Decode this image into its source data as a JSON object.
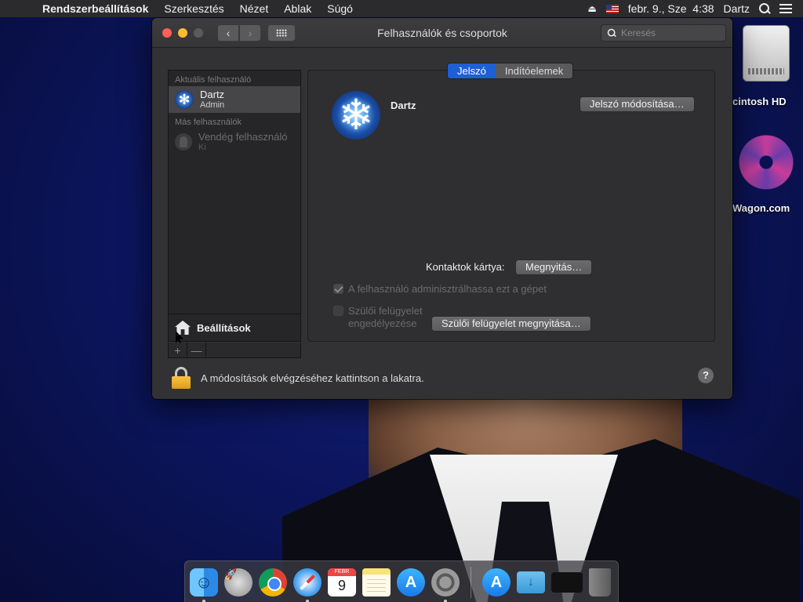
{
  "menubar": {
    "app_name": "Rendszerbeállítások",
    "items": [
      "Szerkesztés",
      "Nézet",
      "Ablak",
      "Súgó"
    ],
    "datetime": "febr. 9., Sze  4:38",
    "user": "Dartz"
  },
  "desktop": {
    "icons": [
      {
        "label": "cintosh HD",
        "icon": "hard-drive-icon"
      },
      {
        "label": "Wagon.com",
        "icon": "star-logo-icon"
      }
    ]
  },
  "window": {
    "title": "Felhasználók és csoportok",
    "search_placeholder": "Keresés",
    "sidebar": {
      "current_user_header": "Aktuális felhasználó",
      "current_user": {
        "name": "Dartz",
        "role": "Admin"
      },
      "other_users_header": "Más felhasználók",
      "other_users": [
        {
          "name": "Vendég felhasználó",
          "role": "Ki"
        }
      ],
      "settings_label": "Beállítások",
      "add_label": "+",
      "remove_label": "—"
    },
    "tabs": [
      {
        "label": "Jelszó",
        "active": true
      },
      {
        "label": "Indítóelemek",
        "active": false
      }
    ],
    "panel": {
      "username": "Dartz",
      "change_password_label": "Jelszó módosítása…",
      "contacts_card_label": "Kontaktok kártya:",
      "open_label": "Megnyitás…",
      "admin_checkbox_label": "A felhasználó adminisztrálhassa ezt a gépet",
      "admin_checked": true,
      "parental_checkbox_label_line1": "Szülői felügyelet",
      "parental_checkbox_label_line2": "engedélyezése",
      "parental_checked": false,
      "parental_open_label": "Szülői felügyelet megnyitása…"
    },
    "lock_text": "A módosítások elvégzéséhez kattintson a lakatra.",
    "help_label": "?"
  },
  "dock": {
    "calendar_month": "FEBR",
    "calendar_day": "9",
    "items": [
      "finder-icon",
      "launchpad-icon",
      "chrome-icon",
      "safari-icon",
      "calendar-icon",
      "notes-icon",
      "app-store-icon",
      "system-preferences-icon",
      "app-store-downloads-icon",
      "downloads-folder-icon",
      "screenshot-icon",
      "trash-icon"
    ]
  }
}
